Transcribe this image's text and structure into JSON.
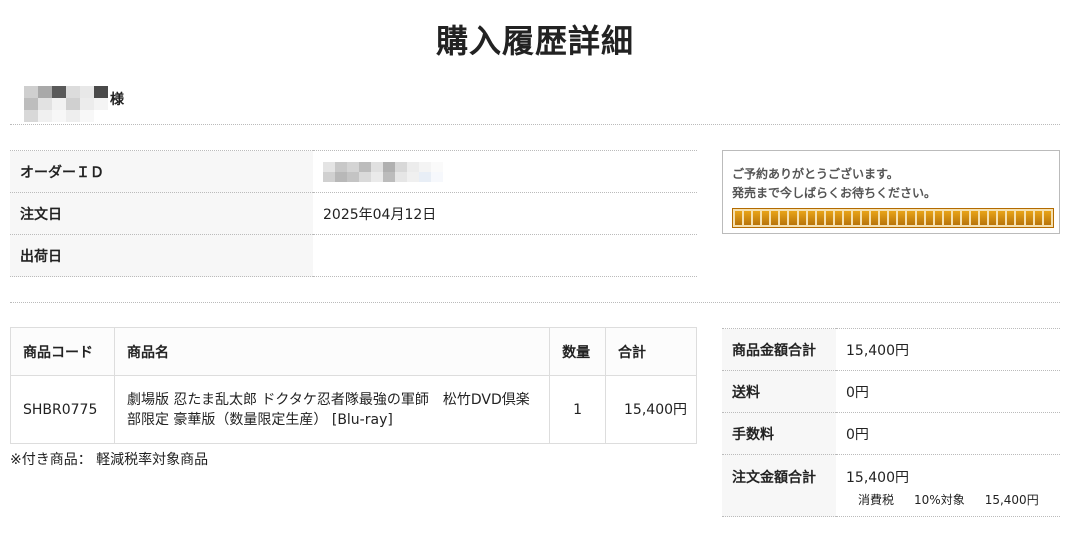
{
  "page": {
    "title": "購入履歴詳細"
  },
  "customer": {
    "honorific": "様"
  },
  "order_info": {
    "id_label": "オーダーＩＤ",
    "date_label": "注文日",
    "date_value": "2025年04月12日",
    "ship_label": "出荷日",
    "ship_value": ""
  },
  "notice": {
    "line1": "ご予約ありがとうございます。",
    "line2": "発売まで今しばらくお待ちください。"
  },
  "items_table": {
    "headers": {
      "code": "商品コード",
      "name": "商品名",
      "qty": "数量",
      "total": "合計"
    },
    "rows": [
      {
        "code": "SHBR0775",
        "name": "劇場版 忍たま乱太郎 ドクタケ忍者隊最強の軍師　松竹DVD倶楽部限定 豪華版（数量限定生産） [Blu-ray]",
        "qty": "1",
        "total": "15,400円"
      }
    ]
  },
  "footnote": "※付き商品： 軽減税率対象商品",
  "totals": {
    "subtotal_label": "商品金額合計",
    "subtotal_value": "15,400円",
    "shipping_label": "送料",
    "shipping_value": "0円",
    "fee_label": "手数料",
    "fee_value": "0円",
    "grand_label": "注文金額合計",
    "grand_value": "15,400円",
    "tax_label": "消費税",
    "tax_rate": "10%対象",
    "tax_amount": "15,400円"
  }
}
